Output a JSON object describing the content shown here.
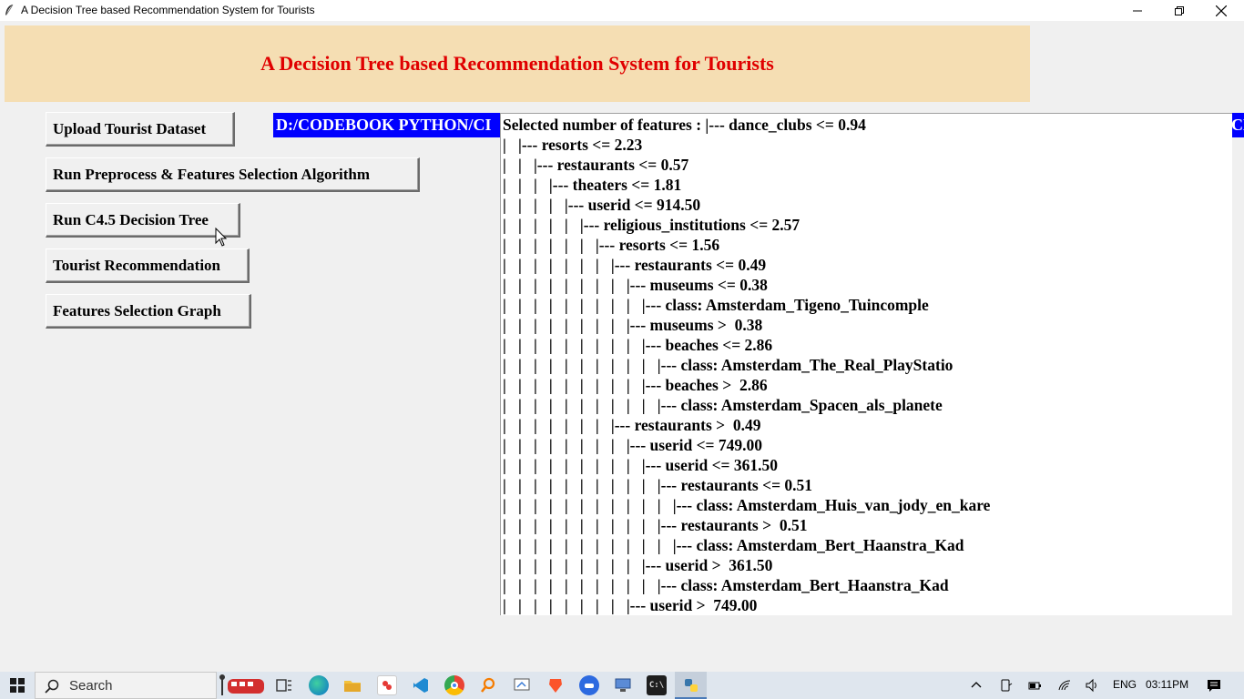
{
  "window": {
    "title": "A Decision Tree based Recommendation System for Tourists"
  },
  "header": {
    "title": "A Decision Tree based Recommendation System for Tourists"
  },
  "buttons": {
    "upload": "Upload Tourist Dataset",
    "preprocess": "Run Preprocess & Features Selection Algorithm",
    "c45": "Run C4.5 Decision Tree",
    "recommend": "Tourist Recommendation",
    "graph": "Features Selection Graph"
  },
  "path_label": {
    "text": "D:/CODEBOOK PYTHON/CI",
    "right_fragment": "CE"
  },
  "output": {
    "lines": [
      "Selected number of features : |--- dance_clubs <= 0.94",
      "|   |--- resorts <= 2.23",
      "|   |   |--- restaurants <= 0.57",
      "|   |   |   |--- theaters <= 1.81",
      "|   |   |   |   |--- userid <= 914.50",
      "|   |   |   |   |   |--- religious_institutions <= 2.57",
      "|   |   |   |   |   |   |--- resorts <= 1.56",
      "|   |   |   |   |   |   |   |--- restaurants <= 0.49",
      "|   |   |   |   |   |   |   |   |--- museums <= 0.38",
      "|   |   |   |   |   |   |   |   |   |--- class: Amsterdam_Tigeno_Tuincomple",
      "|   |   |   |   |   |   |   |   |--- museums >  0.38",
      "|   |   |   |   |   |   |   |   |   |--- beaches <= 2.86",
      "|   |   |   |   |   |   |   |   |   |   |--- class: Amsterdam_The_Real_PlayStatio",
      "|   |   |   |   |   |   |   |   |   |--- beaches >  2.86",
      "|   |   |   |   |   |   |   |   |   |   |--- class: Amsterdam_Spacen_als_planete",
      "|   |   |   |   |   |   |   |--- restaurants >  0.49",
      "|   |   |   |   |   |   |   |   |--- userid <= 749.00",
      "|   |   |   |   |   |   |   |   |   |--- userid <= 361.50",
      "|   |   |   |   |   |   |   |   |   |   |--- restaurants <= 0.51",
      "|   |   |   |   |   |   |   |   |   |   |   |--- class: Amsterdam_Huis_van_jody_en_kare",
      "|   |   |   |   |   |   |   |   |   |   |--- restaurants >  0.51",
      "|   |   |   |   |   |   |   |   |   |   |   |--- class: Amsterdam_Bert_Haanstra_Kad",
      "|   |   |   |   |   |   |   |   |   |--- userid >  361.50",
      "|   |   |   |   |   |   |   |   |   |   |--- class: Amsterdam_Bert_Haanstra_Kad",
      "|   |   |   |   |   |   |   |   |--- userid >  749.00"
    ]
  },
  "taskbar": {
    "search_placeholder": "Search",
    "language": "ENG",
    "time": "03:11PM",
    "icons": [
      "task-view-icon",
      "edge-icon",
      "file-explorer-icon",
      "app-red-icon",
      "vscode-icon",
      "chrome-icon",
      "orange-search-app-icon",
      "paint-app-icon",
      "brave-icon",
      "zoom-icon",
      "remote-desktop-icon",
      "terminal-icon",
      "python-app-icon"
    ]
  },
  "colors": {
    "banner_bg": "#f5deb3",
    "banner_text": "#e00000",
    "path_bg": "#0000ff"
  }
}
